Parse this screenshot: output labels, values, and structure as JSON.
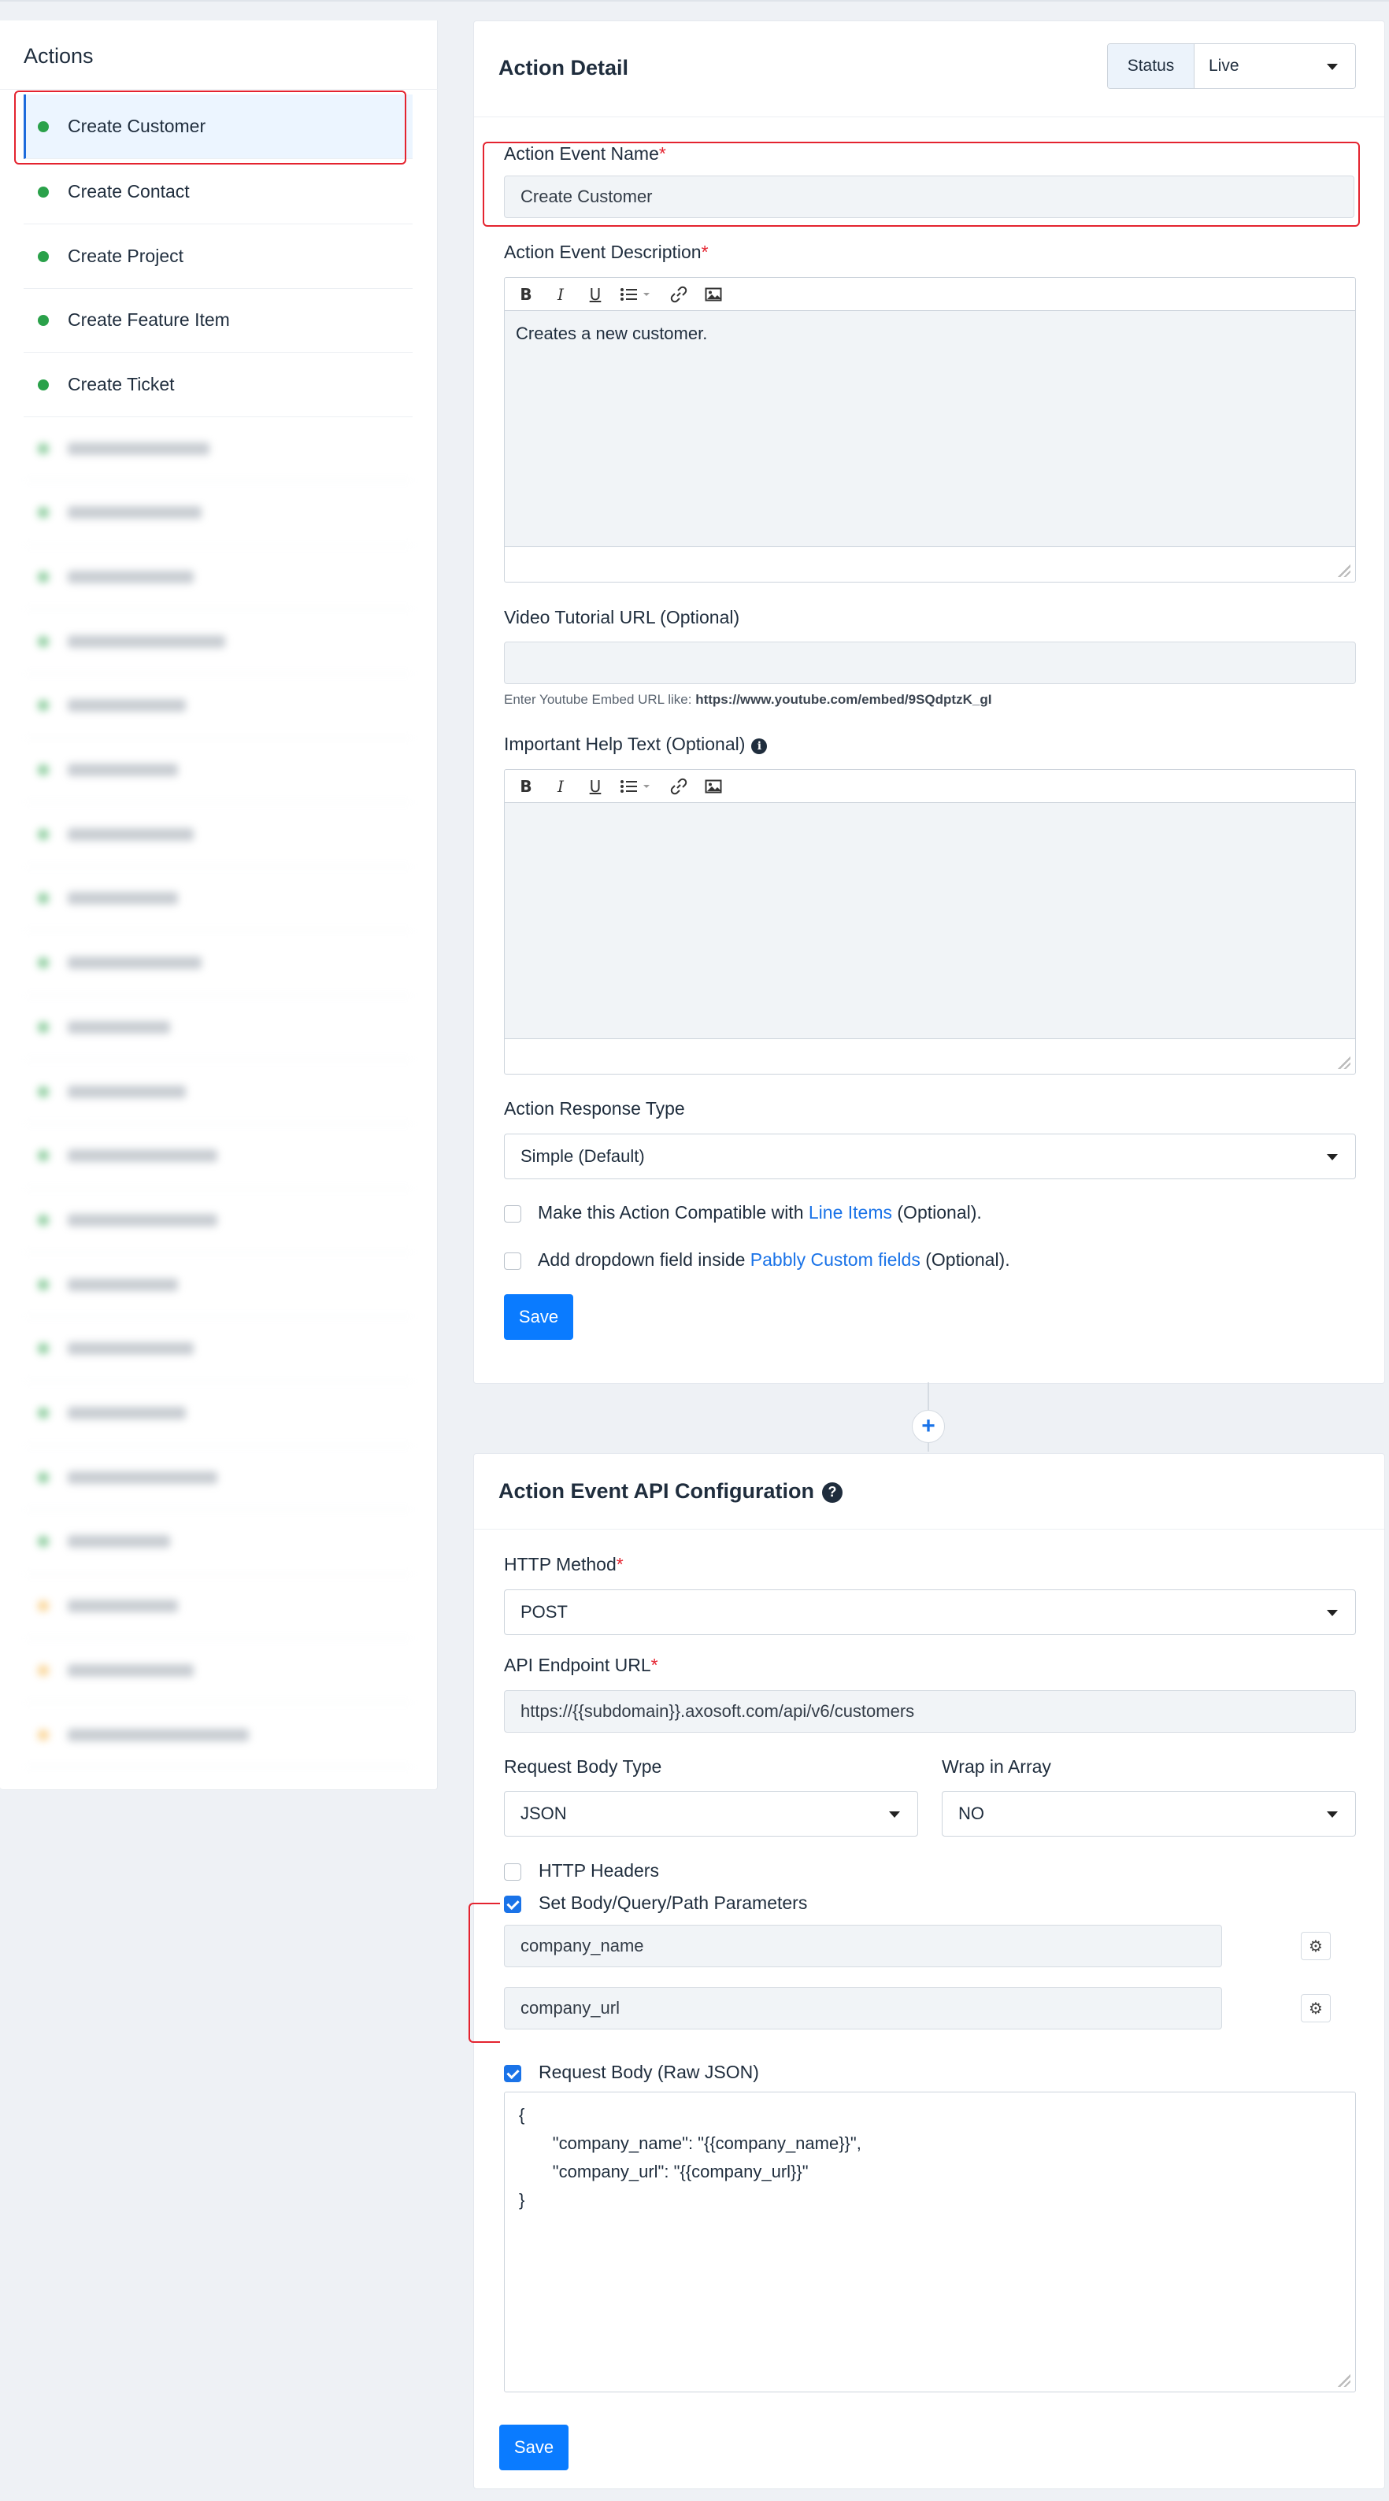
{
  "sidebar": {
    "title": "Actions",
    "items": [
      {
        "label": "Create Customer",
        "status": "green",
        "active": true
      },
      {
        "label": "Create Contact",
        "status": "green"
      },
      {
        "label": "Create Project",
        "status": "green"
      },
      {
        "label": "Create Feature Item",
        "status": "green"
      },
      {
        "label": "Create Ticket",
        "status": "green"
      }
    ],
    "blurred_item_count": 21
  },
  "action_detail": {
    "title": "Action Detail",
    "status_label": "Status",
    "status_value": "Live",
    "event_name_label": "Action Event Name",
    "event_name_value": "Create Customer",
    "event_desc_label": "Action Event Description",
    "event_desc_value": "Creates a new customer.",
    "video_label": "Video Tutorial URL (Optional)",
    "video_value": "",
    "video_hint_prefix": "Enter Youtube Embed URL like: ",
    "video_hint_url": "https://www.youtube.com/embed/9SQdptzK_gI",
    "help_label": "Important Help Text (Optional)",
    "help_value": "",
    "response_type_label": "Action Response Type",
    "response_type_value": "Simple (Default)",
    "line_items_prefix": "Make this Action Compatible with ",
    "line_items_link": "Line Items",
    "line_items_suffix": " (Optional).",
    "dropdown_prefix": "Add dropdown field inside ",
    "dropdown_link": "Pabbly Custom fields",
    "dropdown_suffix": " (Optional).",
    "save_label": "Save"
  },
  "api_config": {
    "title": "Action Event API Configuration",
    "http_method_label": "HTTP Method",
    "http_method_value": "POST",
    "endpoint_label": "API Endpoint URL",
    "endpoint_value": "https://{{subdomain}}.axosoft.com/api/v6/customers",
    "body_type_label": "Request Body Type",
    "body_type_value": "JSON",
    "wrap_label": "Wrap in Array",
    "wrap_value": "NO",
    "http_headers_label": "HTTP Headers",
    "http_headers_checked": false,
    "params_label": "Set Body/Query/Path Parameters",
    "params_checked": true,
    "params": [
      "company_name",
      "company_url"
    ],
    "raw_body_label": "Request Body (Raw JSON)",
    "raw_body_checked": true,
    "raw_body_lines": [
      "{",
      "       \"company_name\": \"{{company_name}}\",",
      "       \"company_url\": \"{{company_url}}\"",
      "}"
    ],
    "save_label": "Save"
  },
  "colors": {
    "accent": "#0a7bff",
    "link": "#1a73e8",
    "status_live": "#2aa14a",
    "highlight": "#e4232f"
  }
}
